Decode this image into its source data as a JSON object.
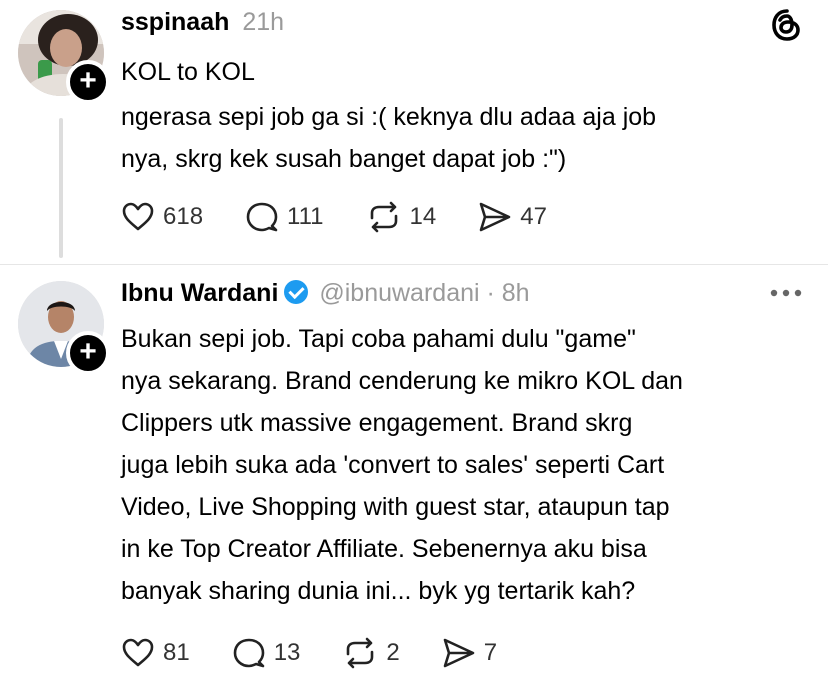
{
  "post1": {
    "username": "sspinaah",
    "time": "21h",
    "title": "KOL to KOL",
    "text_lines": [
      "ngerasa sepi job ga si :( keknya dlu adaa aja job",
      "nya, skrg kek susah banget dapat job :\")"
    ],
    "likes": "618",
    "replies": "111",
    "reposts": "14",
    "shares": "47"
  },
  "post2": {
    "username": "Ibnu Wardani",
    "handle": "@ibnuwardani · 8h",
    "text_lines": [
      "Bukan sepi job. Tapi coba pahami dulu \"game\"",
      "nya sekarang. Brand cenderung ke mikro KOL dan",
      "Clippers utk massive engagement. Brand skrg",
      "juga lebih suka ada 'convert to sales' seperti Cart",
      "Video, Live Shopping with guest star, ataupun tap",
      "in ke Top Creator Affiliate. Sebenernya aku bisa",
      "banyak sharing dunia ini... byk yg tertarik kah?"
    ],
    "likes": "81",
    "replies": "13",
    "reposts": "2",
    "shares": "7"
  },
  "icons": {
    "app_logo": "threads-icon",
    "more": "more-options-icon",
    "like": "heart-icon",
    "reply": "comment-icon",
    "repost": "repost-icon",
    "share": "send-icon"
  }
}
